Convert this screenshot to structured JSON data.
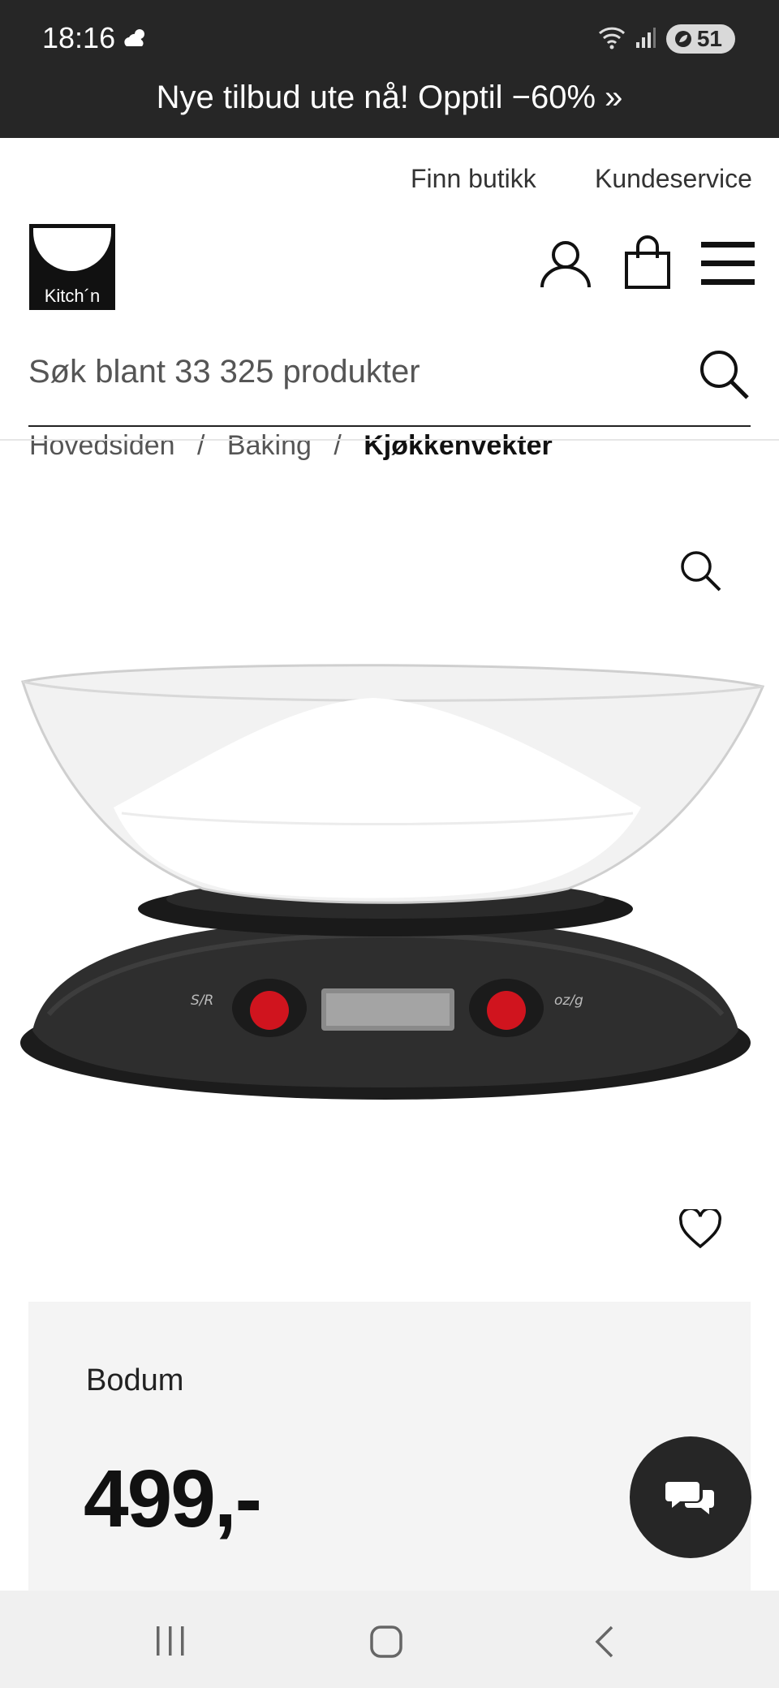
{
  "status_bar": {
    "time": "18:16",
    "battery": "51"
  },
  "promo": {
    "text": "Nye tilbud ute nå! Opptil −60% »"
  },
  "header": {
    "links": [
      "Finn butikk",
      "Kundeservice"
    ],
    "logo_text": "Kitch´n",
    "icons": [
      "user-icon",
      "shopping-bag-icon",
      "menu-icon"
    ]
  },
  "search": {
    "placeholder": "Søk blant 33 325 produkter"
  },
  "breadcrumb": {
    "items": [
      "Hovedsiden",
      "Baking",
      "Kjøkkenvekter"
    ],
    "separator": "/"
  },
  "product": {
    "brand": "Bodum",
    "price": "499,-",
    "scale_labels": [
      "S/R",
      "oz/g"
    ]
  },
  "colors": {
    "topbar": "#262626",
    "accent_button": "#d0141e",
    "panel": "#f4f4f4"
  }
}
